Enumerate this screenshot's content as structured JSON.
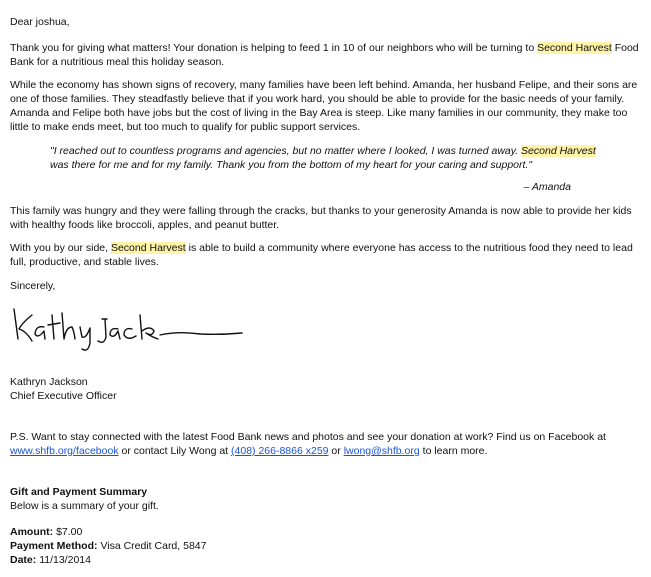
{
  "letter": {
    "greeting": "Dear joshua,",
    "para1": {
      "before": "Thank you for giving what matters! Your donation is helping to feed 1 in 10 of our neighbors who will be turning to ",
      "highlight": "Second Harvest",
      "after": " Food Bank for a nutritious meal this holiday season."
    },
    "para2": "While the economy has shown signs of recovery, many families have been left behind. Amanda, her husband Felipe, and their sons are one of those families. They steadfastly believe that if you work hard, you should be able to provide for the basic needs of your family. Amanda and Felipe both have jobs but the cost of living in the Bay Area is steep. Like many families in our community, they make too little to make ends meet, but too much to qualify for public support services.",
    "quote": {
      "before": "\"I reached out to countless programs and agencies, but no matter where I looked, I was turned away. ",
      "highlight": "Second Harvest",
      "after": " was there for me and for my family. Thank you from the bottom of my heart for your caring and support.\""
    },
    "quote_attribution": "– Amanda",
    "para3": "This family was hungry and they were falling through the cracks, but thanks to your generosity Amanda is now able to provide her kids with healthy foods like broccoli, apples, and peanut butter.",
    "para4": {
      "before": "With you by our side, ",
      "highlight": "Second Harvest",
      "after": " is able to build a community where everyone has access to the nutritious food they need to lead full, productive, and stable lives."
    },
    "closing": "Sincerely,",
    "signature_text": "Kathryn Jackson",
    "signer_name": "Kathryn Jackson",
    "signer_title": "Chief Executive Officer",
    "ps": {
      "text1": "P.S. Want to stay connected with the latest Food Bank news and photos and see your donation at work? Find us on Facebook at ",
      "link1": "www.shfb.org/facebook",
      "text2": " or contact Lily Wong at ",
      "link2": "(408) 266-8866 x259",
      "text3": " or ",
      "link3": "lwong@shfb.org",
      "text4": " to learn more."
    }
  },
  "summary": {
    "heading": "Gift and Payment Summary",
    "intro": "Below is a summary of your gift.",
    "amount_label": "Amount:",
    "amount_value": "$7.00",
    "method_label": "Payment Method:",
    "method_value": "Visa Credit Card, 5847",
    "date_label": "Date:",
    "date_value": "11/13/2014"
  },
  "colors": {
    "highlight": "#fff3a8",
    "link": "#1a55d6"
  }
}
